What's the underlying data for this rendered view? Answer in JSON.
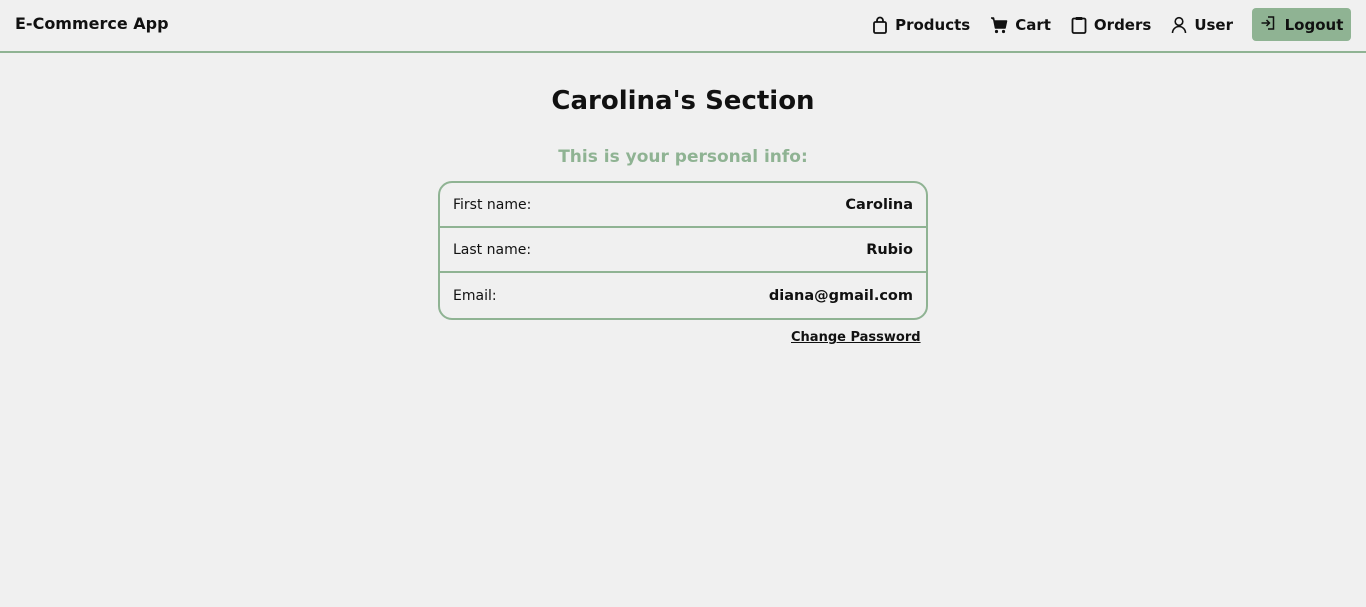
{
  "navbar": {
    "brand": "E-Commerce App",
    "links": {
      "products": "Products",
      "cart": "Cart",
      "orders": "Orders",
      "user": "User"
    },
    "logout": "Logout"
  },
  "main": {
    "title": "Carolina's Section",
    "subtitle": "This is your personal info:",
    "rows": [
      {
        "label": "First name:",
        "value": "Carolina"
      },
      {
        "label": "Last name:",
        "value": "Rubio"
      },
      {
        "label": "Email:",
        "value": "diana@gmail.com"
      }
    ],
    "change_password": "Change Password"
  },
  "icons": {
    "products": "shopping-bag-icon",
    "cart": "cart-icon",
    "orders": "clipboard-icon",
    "user": "user-icon",
    "logout": "logout-icon"
  },
  "colors": {
    "accent": "#8fb393",
    "background": "#f0f0f0",
    "text": "#111111"
  }
}
